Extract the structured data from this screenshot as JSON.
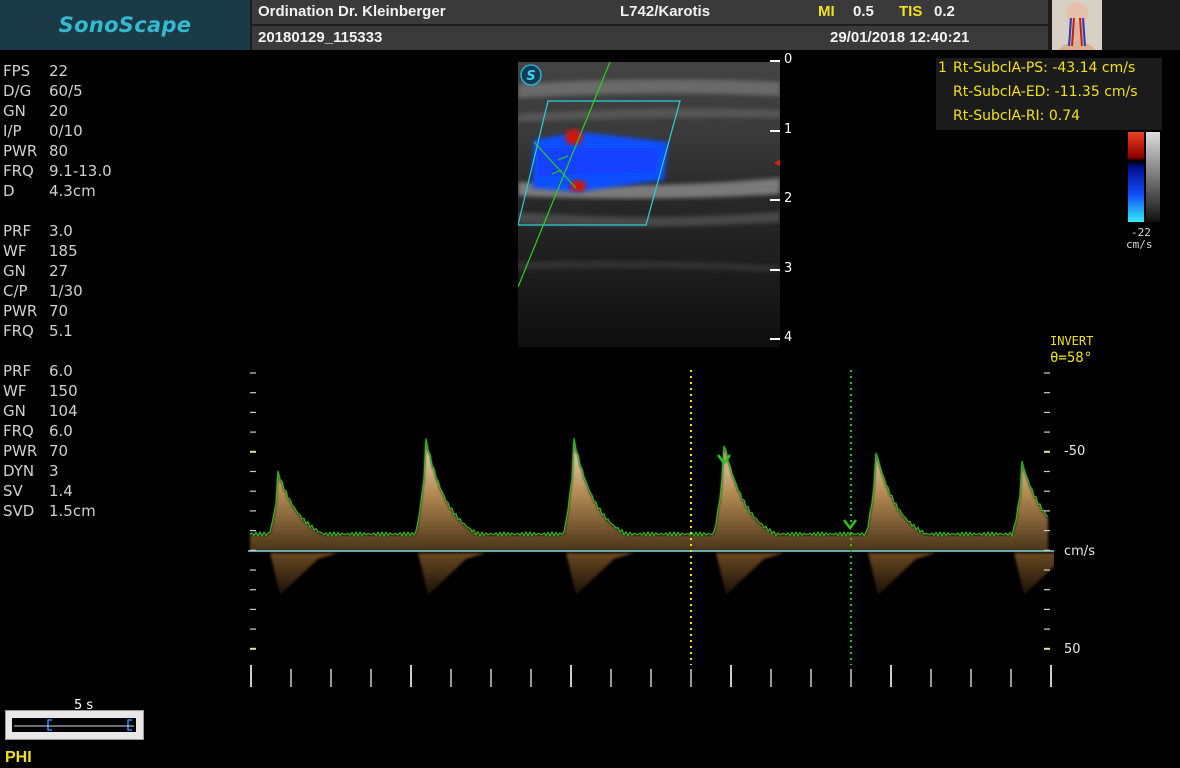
{
  "header": {
    "brand": "SonoScape",
    "institution": "Ordination Dr. Kleinberger",
    "probe_preset": "L742/Karotis",
    "mi_label": "MI",
    "mi_value": "0.5",
    "tis_label": "TIS",
    "tis_value": "0.2",
    "patient_id": "20180129_115333",
    "datetime": "29/01/2018 12:40:21"
  },
  "params_bmode": [
    {
      "key": "FPS",
      "value": "22"
    },
    {
      "key": "D/G",
      "value": "60/5"
    },
    {
      "key": "GN",
      "value": "20"
    },
    {
      "key": "I/P",
      "value": "0/10"
    },
    {
      "key": "PWR",
      "value": "80"
    },
    {
      "key": "FRQ",
      "value": "9.1-13.0"
    },
    {
      "key": "D",
      "value": "4.3cm"
    }
  ],
  "params_color": [
    {
      "key": "PRF",
      "value": "3.0"
    },
    {
      "key": "WF",
      "value": "185"
    },
    {
      "key": "GN",
      "value": "27"
    },
    {
      "key": "C/P",
      "value": "1/30"
    },
    {
      "key": "PWR",
      "value": "70"
    },
    {
      "key": "FRQ",
      "value": "5.1"
    }
  ],
  "params_pw": [
    {
      "key": "PRF",
      "value": "6.0"
    },
    {
      "key": "WF",
      "value": "150"
    },
    {
      "key": "GN",
      "value": "104"
    },
    {
      "key": "FRQ",
      "value": "6.0"
    },
    {
      "key": "PWR",
      "value": "70"
    },
    {
      "key": "DYN",
      "value": "3"
    },
    {
      "key": "SV",
      "value": "1.4"
    },
    {
      "key": "SVD",
      "value": "1.5cm"
    }
  ],
  "depth_scale": [
    "0",
    "1",
    "2",
    "3",
    "4"
  ],
  "measurements": {
    "index": "1",
    "ps": "Rt-SubclA-PS: -43.14 cm/s",
    "ed": "Rt-SubclA-ED: -11.35 cm/s",
    "ri": "Rt-SubclA-RI: 0.74"
  },
  "color_bar": {
    "bottom_value": "-22",
    "unit": "cm/s"
  },
  "doppler": {
    "invert_label": "INVERT",
    "angle": "θ=58°",
    "top_label": "-50",
    "baseline_label": "cm/s",
    "bottom_label": "50"
  },
  "sweep_scale": {
    "label": "5 s"
  },
  "footer": {
    "phi": "PHI"
  },
  "colors": {
    "brand": "#34b9cf",
    "header_bg": "#3a3a3a",
    "yellow": "#f0e020",
    "trace_green": "#30c020",
    "baseline": "#7fd8e0",
    "flow_blue": "#1060ff",
    "flow_red": "#e02010"
  }
}
